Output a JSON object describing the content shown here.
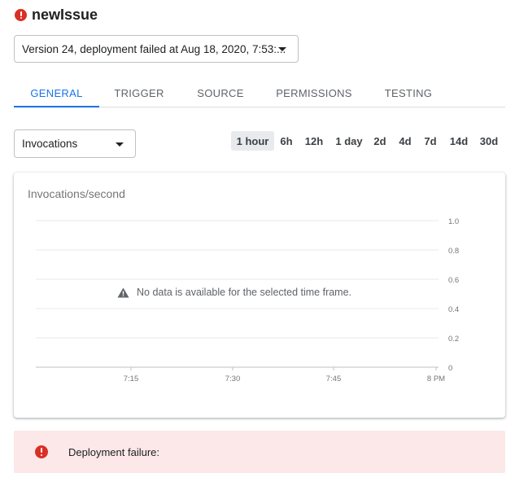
{
  "function": {
    "name": "newIssue",
    "status_icon": "error-icon",
    "status_color": "#d93025"
  },
  "version_select": {
    "value": "Version 24, deployment failed at Aug 18, 2020, 7:53:..."
  },
  "tabs": [
    {
      "label": "GENERAL",
      "active": true
    },
    {
      "label": "TRIGGER"
    },
    {
      "label": "SOURCE"
    },
    {
      "label": "PERMISSIONS"
    },
    {
      "label": "TESTING"
    }
  ],
  "metric_select": {
    "value": "Invocations"
  },
  "time_ranges": [
    {
      "label": "1 hour",
      "active": true
    },
    {
      "label": "6h"
    },
    {
      "label": "12h"
    },
    {
      "label": "1 day"
    },
    {
      "label": "2d"
    },
    {
      "label": "4d"
    },
    {
      "label": "7d"
    },
    {
      "label": "14d"
    },
    {
      "label": "30d"
    }
  ],
  "chart": {
    "no_data_message": "No data is available for the selected time frame."
  },
  "chart_data": {
    "type": "line",
    "title": "Invocations/second",
    "xlabel": "",
    "ylabel": "",
    "x_ticks": [
      "7:15",
      "7:30",
      "7:45",
      "8 PM"
    ],
    "y_ticks": [
      "0",
      "0.2",
      "0.4",
      "0.6",
      "0.8",
      "1.0"
    ],
    "ylim": [
      0,
      1.0
    ],
    "series": [],
    "grid": true,
    "y_axis_side": "right"
  },
  "banner": {
    "message": "Deployment failure:",
    "background": "#fce8e8",
    "icon": "error-icon"
  },
  "colors": {
    "accent": "#1a73e8",
    "error": "#d93025"
  }
}
